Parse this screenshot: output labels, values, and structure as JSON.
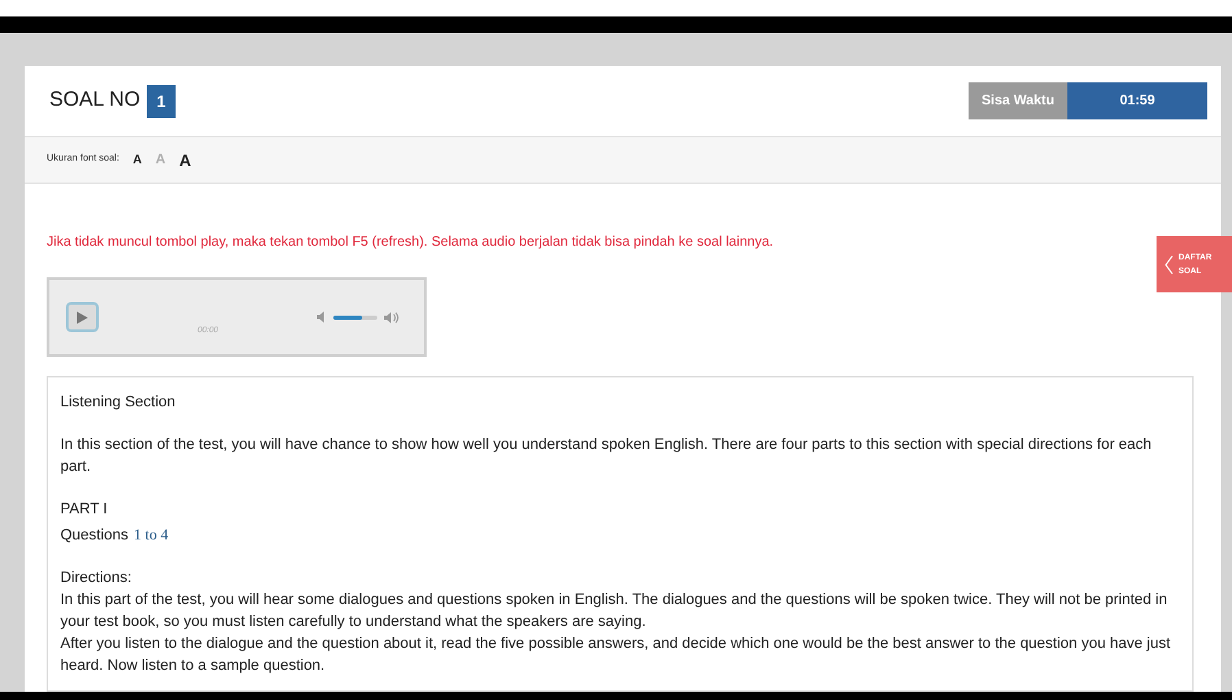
{
  "header": {
    "title": "SOAL NO",
    "number": "1",
    "timer_label": "Sisa Waktu",
    "timer_value": "01:59"
  },
  "font_toolbar": {
    "label": "Ukuran font soal:",
    "options": [
      {
        "kind": "small",
        "text": "A",
        "selected": false
      },
      {
        "kind": "medium",
        "text": "A",
        "selected": true
      },
      {
        "kind": "large",
        "text": "A",
        "selected": false
      }
    ]
  },
  "notice": "Jika tidak muncul tombol play, maka tekan tombol F5 (refresh). Selama audio berjalan tidak bisa pindah ke soal lainnya.",
  "audio_player": {
    "time": "00:00",
    "volume": {
      "level": 0.65
    }
  },
  "side_tab": {
    "label_1": "DAFTAR",
    "label_2": "SOAL"
  },
  "content": {
    "heading": "Listening Section",
    "intro": "In this section of the test, you will have chance to show how well you understand spoken English. There are four parts to this section with special directions for each part.",
    "part": "PART I",
    "questions_label": "Questions",
    "questions_range": "1 to 4",
    "directions_heading": "Directions:",
    "directions": [
      "In this part of the test, you will hear some dialogues and questions spoken in English. The dialogues and the questions will be spoken twice. They will not be printed in your test book, so you must listen carefully to understand what the speakers are saying.",
      "After you listen to the dialogue and the question about it, read the five possible answers, and decide which one would be the best answer to the question you have just heard. Now listen to a sample question."
    ]
  }
}
